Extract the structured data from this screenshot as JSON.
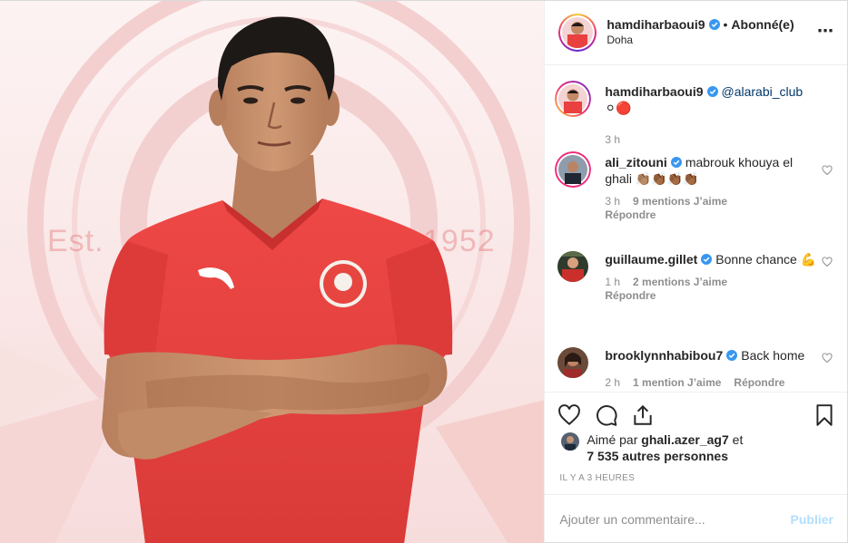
{
  "header": {
    "username": "hamdiharbaoui9",
    "separator": "•",
    "follow_label": "Abonné(e)",
    "location": "Doha",
    "more_icon": "⋯"
  },
  "photo": {
    "crest_left_text": "Est.",
    "crest_right_text": "1952"
  },
  "caption": {
    "username": "hamdiharbaoui9",
    "mention": "@alarabi_club",
    "emoji": "⚪🔴",
    "time": "3 h"
  },
  "comments": [
    {
      "username": "ali_zitouni",
      "text": "mabrouk khouya el ghali 👏🏽👏🏾👏🏾👏🏾",
      "time": "3 h",
      "likes": "9 mentions J’aime",
      "reply": "Répondre"
    },
    {
      "username": "guillaume.gillet",
      "text": "Bonne chance 💪",
      "time": "1 h",
      "likes": "2 mentions J’aime",
      "reply": "Répondre"
    },
    {
      "username": "brooklynnhabibou7",
      "text": "Back home",
      "time": "2 h",
      "likes": "1 mention J’aime",
      "reply": "Répondre"
    }
  ],
  "likes_summary": {
    "prefix": "Aimé par",
    "user": "ghali.azer_ag7",
    "connector": "et",
    "others": "7 535 autres personnes"
  },
  "timestamp": "IL Y A 3 HEURES",
  "add_comment": {
    "placeholder": "Ajouter un commentaire...",
    "publish_label": "Publier"
  },
  "colors": {
    "verified": "#3897f0",
    "jersey": "#e8413f",
    "publish_disabled": "#b2dffc",
    "meta_gray": "#8e8e8e"
  },
  "icons": [
    "heart-icon",
    "comment-icon",
    "share-icon",
    "bookmark-icon",
    "verified-icon",
    "more-options-icon"
  ]
}
